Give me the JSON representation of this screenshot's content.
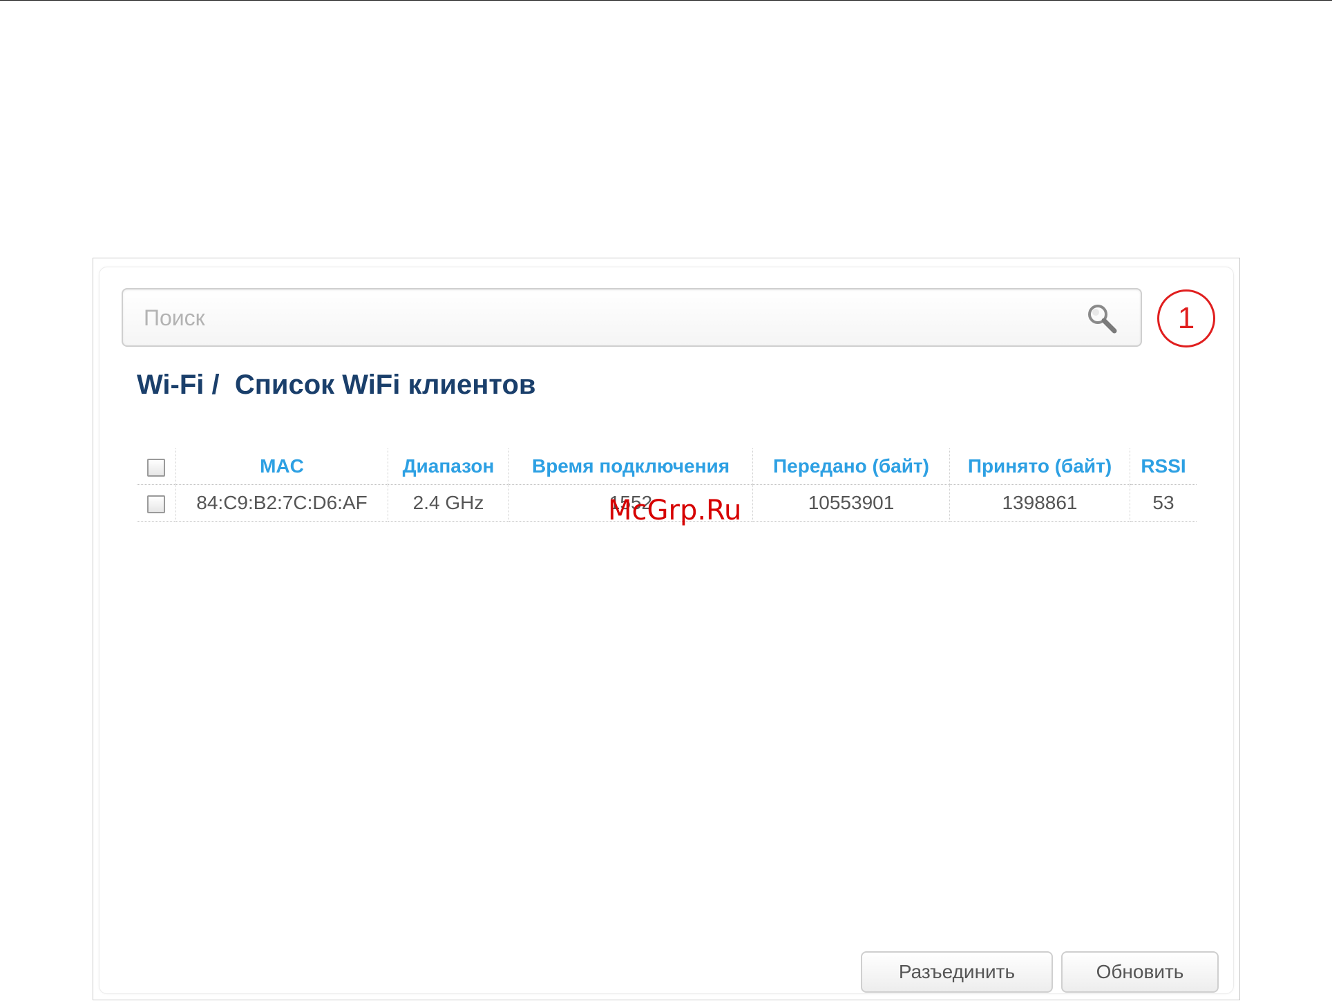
{
  "search": {
    "placeholder": "Поиск"
  },
  "badge": {
    "number": "1",
    "color": "#e01e1e"
  },
  "page": {
    "title": "Wi-Fi /  Список WiFi клиентов"
  },
  "table": {
    "columns": [
      "MAC",
      "Диапазон",
      "Время подключения",
      "Передано (байт)",
      "Принято (байт)",
      "RSSI"
    ],
    "rows": [
      {
        "mac": "84:C9:B2:7C:D6:AF",
        "band": "2.4 GHz",
        "connection_time": "1552",
        "sent": "10553901",
        "received": "1398861",
        "rssi": "53"
      }
    ]
  },
  "watermark": "McGrp.Ru",
  "buttons": {
    "disconnect": "Разъединить",
    "refresh": "Обновить"
  },
  "colors": {
    "title": "#1a3f6b",
    "header_link": "#2da0e3",
    "watermark": "#d60000"
  }
}
